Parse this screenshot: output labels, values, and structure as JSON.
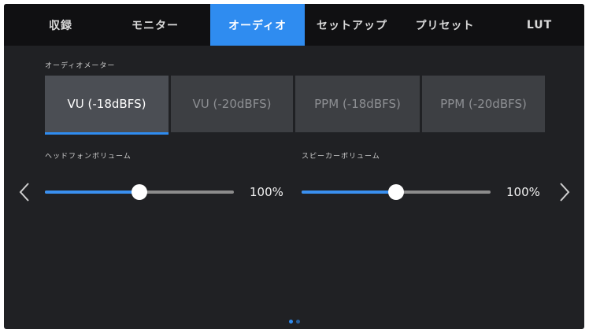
{
  "tabs": [
    {
      "label": "収録",
      "active": false
    },
    {
      "label": "モニター",
      "active": false
    },
    {
      "label": "オーディオ",
      "active": true
    },
    {
      "label": "セットアップ",
      "active": false
    },
    {
      "label": "プリセット",
      "active": false
    },
    {
      "label": "LUT",
      "active": false
    }
  ],
  "audio_meter": {
    "label": "オーディオメーター",
    "options": [
      "VU (-18dBFS)",
      "VU (-20dBFS)",
      "PPM (-18dBFS)",
      "PPM (-20dBFS)"
    ],
    "selected": "VU (-18dBFS)"
  },
  "headphone_volume": {
    "label": "ヘッドフォンボリューム",
    "value_text": "100%",
    "level": 0.5
  },
  "speaker_volume": {
    "label": "スピーカーボリューム",
    "value_text": "100%",
    "level": 0.5
  },
  "nav": {
    "prev": "chevron-left-icon",
    "next": "chevron-right-icon"
  },
  "page_indicator": {
    "pages": 2,
    "current": 1
  },
  "colors": {
    "accent": "#2f8cf0",
    "background": "#202124",
    "tabbar": "#101012"
  }
}
